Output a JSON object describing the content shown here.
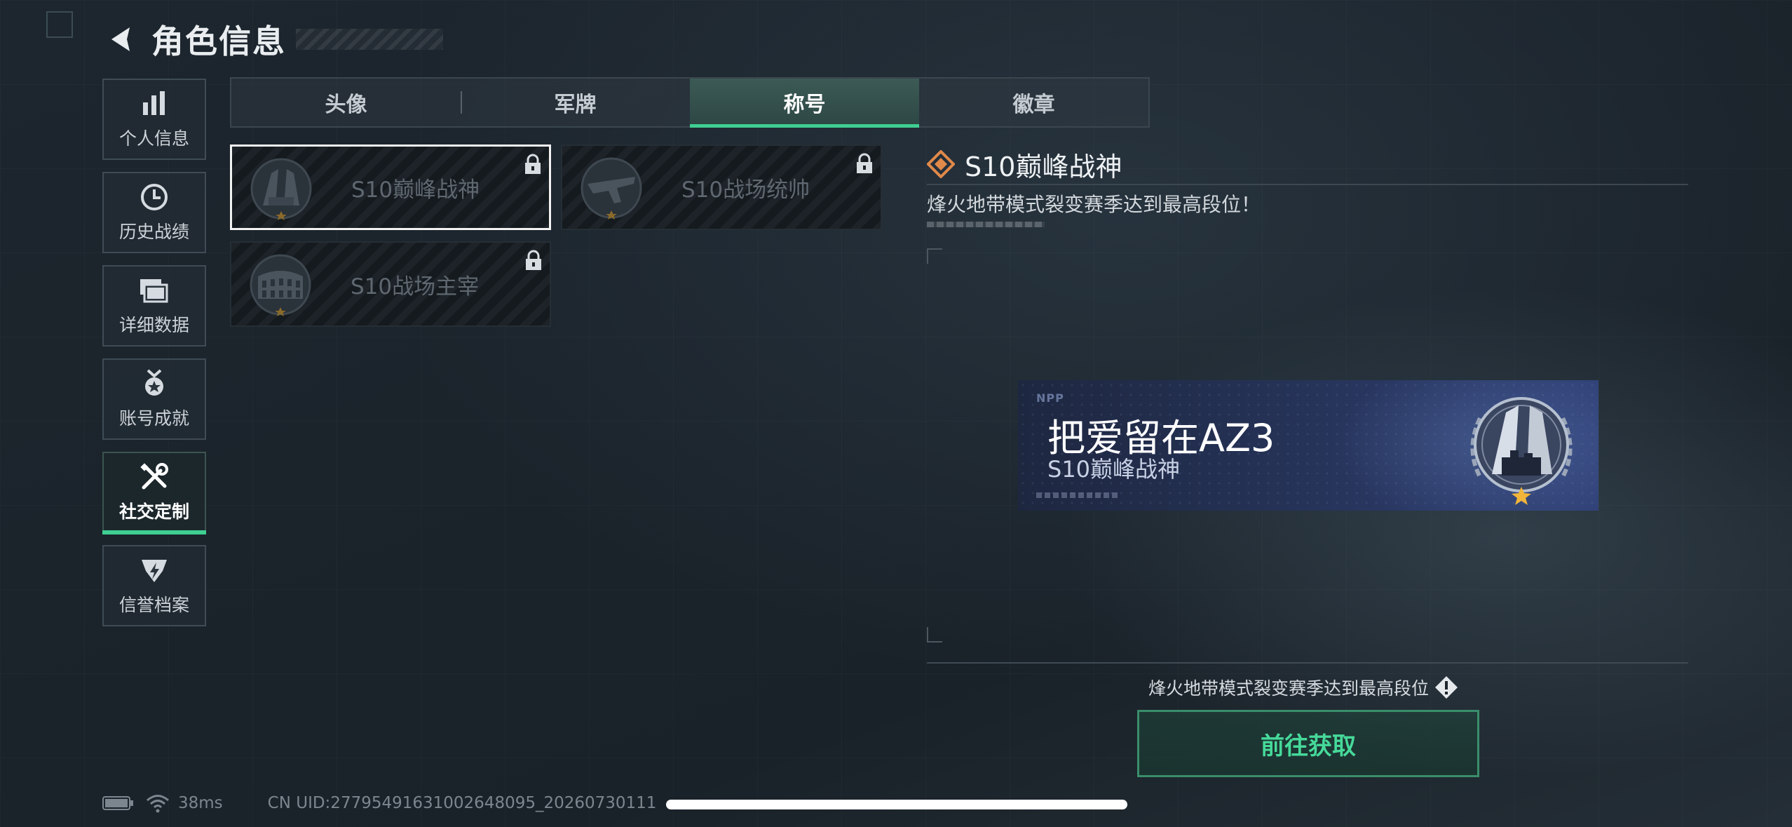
{
  "header": {
    "title": "角色信息"
  },
  "sidebar": {
    "items": [
      {
        "label": "个人信息",
        "icon": "bar-chart-icon"
      },
      {
        "label": "历史战绩",
        "icon": "clock-icon"
      },
      {
        "label": "详细数据",
        "icon": "folder-stack-icon"
      },
      {
        "label": "账号成就",
        "icon": "medal-icon"
      },
      {
        "label": "社交定制",
        "icon": "wrench-screwdriver-icon",
        "active": true
      },
      {
        "label": "信誉档案",
        "icon": "shield-badge-icon"
      }
    ]
  },
  "tabs": [
    {
      "label": "头像"
    },
    {
      "label": "军牌"
    },
    {
      "label": "称号",
      "active": true
    },
    {
      "label": "徽章"
    }
  ],
  "titles": [
    {
      "name": "S10巅峰战神",
      "locked": true,
      "selected": true
    },
    {
      "name": "S10战场统帅",
      "locked": true,
      "selected": false
    },
    {
      "name": "S10战场主宰",
      "locked": true,
      "selected": false
    }
  ],
  "detail": {
    "title": "S10巅峰战神",
    "description": "烽火地带模式裂变赛季达到最高段位！"
  },
  "preview": {
    "logo": "NPP",
    "player_name": "把爱留在AZ3",
    "title": "S10巅峰战神"
  },
  "requirement": {
    "text": "烽火地带模式裂变赛季达到最高段位",
    "button": "前往获取"
  },
  "status_bar": {
    "ping": "38ms",
    "uid": "CN UID:27795491631002648095_20260730111"
  },
  "colors": {
    "accent": "#3fcf92",
    "title_icon": "#e0894a"
  }
}
